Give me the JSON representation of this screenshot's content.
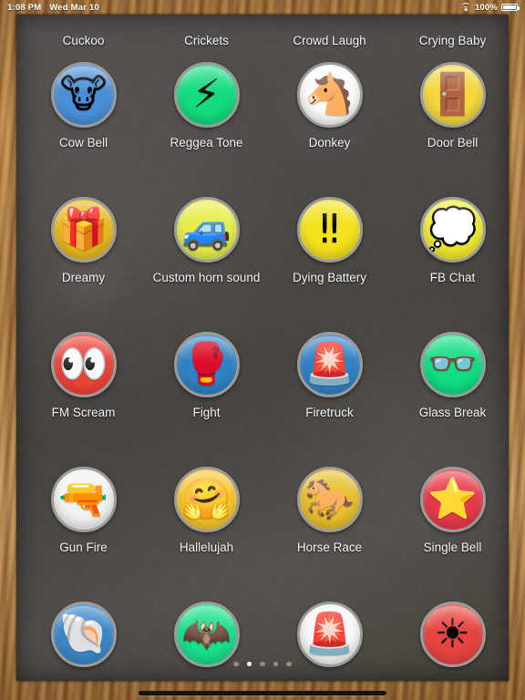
{
  "statusbar": {
    "time": "1:08 PM",
    "date": "Wed Mar 10",
    "battery_percent": "100%",
    "wifi_icon": "wifi-icon",
    "battery_icon": "battery-full-icon"
  },
  "app": {
    "background": "chalkboard",
    "frame": "wood"
  },
  "top_partial_row": {
    "labels": [
      "Cuckoo",
      "Crickets",
      "Crowd Laugh",
      "Crying Baby"
    ]
  },
  "colors": {
    "board_bg": "#4c4946",
    "frame_wood": "#b57f45",
    "label_text": "#f2f2f2",
    "icon_ring": "#9b9b99",
    "dot_active": "#ffffff",
    "dot_inactive": "#8d8b88"
  },
  "tiles": [
    {
      "label": "Cow Bell",
      "glyph": "🐮",
      "icon_name": "cow-face-icon",
      "bg": "#4a90d9"
    },
    {
      "label": "Reggea Tone",
      "glyph": "⚡",
      "icon_name": "lightning-bolt-icon",
      "bg": "#13dc7e"
    },
    {
      "label": "Donkey",
      "glyph": "🐴",
      "icon_name": "horse-face-icon",
      "bg": "#fbfbfb"
    },
    {
      "label": "Door Bell",
      "glyph": "🚪",
      "icon_name": "door-icon",
      "bg": "#f4d83c"
    },
    {
      "label": "Dreamy",
      "glyph": "🎁",
      "icon_name": "gift-icon",
      "bg": "#e8b81d"
    },
    {
      "label": "Custom horn sound",
      "glyph": "🚙",
      "icon_name": "car-icon",
      "bg": "#e6ee45"
    },
    {
      "label": "Dying Battery",
      "glyph": "‼",
      "icon_name": "double-exclamation-icon",
      "bg": "#f4e21c"
    },
    {
      "label": "FB Chat",
      "glyph": "💭",
      "icon_name": "thought-balloon-icon",
      "bg": "#f0ea2c"
    },
    {
      "label": "FM Scream",
      "glyph": "👀",
      "icon_name": "eyes-icon",
      "bg": "#ef4236"
    },
    {
      "label": "Fight",
      "glyph": "🥊",
      "icon_name": "boxing-glove-icon",
      "bg": "#2f82c4"
    },
    {
      "label": "Firetruck",
      "glyph": "🚨",
      "icon_name": "police-light-icon",
      "bg": "#2f82c4"
    },
    {
      "label": "Glass Break",
      "glyph": "👓",
      "icon_name": "eyeglasses-icon",
      "bg": "#10dd84"
    },
    {
      "label": "Gun Fire",
      "glyph": "🔫",
      "icon_name": "pistol-icon",
      "bg": "#f2f2f2"
    },
    {
      "label": "Hallelujah",
      "glyph": "🤗",
      "icon_name": "hugging-face-icon",
      "bg": "#f7c52b"
    },
    {
      "label": "Horse Race",
      "glyph": "🐎",
      "icon_name": "racehorse-icon",
      "bg": "#e8bf2b"
    },
    {
      "label": "Single Bell",
      "glyph": "⭐",
      "icon_name": "star-icon",
      "bg": "#e8394a"
    },
    {
      "label": "",
      "glyph": "🐚",
      "icon_name": "spiral-shell-icon",
      "bg": "#3a87c9"
    },
    {
      "label": "",
      "glyph": "🦇",
      "icon_name": "bat-icon",
      "bg": "#17e08c"
    },
    {
      "label": "",
      "glyph": "🚨",
      "icon_name": "police-light-icon",
      "bg": "#f7f7f7"
    },
    {
      "label": "",
      "glyph": "☀",
      "icon_name": "sun-icon",
      "bg": "#e8443f"
    }
  ],
  "pagination": {
    "total_pages": 5,
    "current_page": 2
  },
  "home_indicator": "home-indicator"
}
